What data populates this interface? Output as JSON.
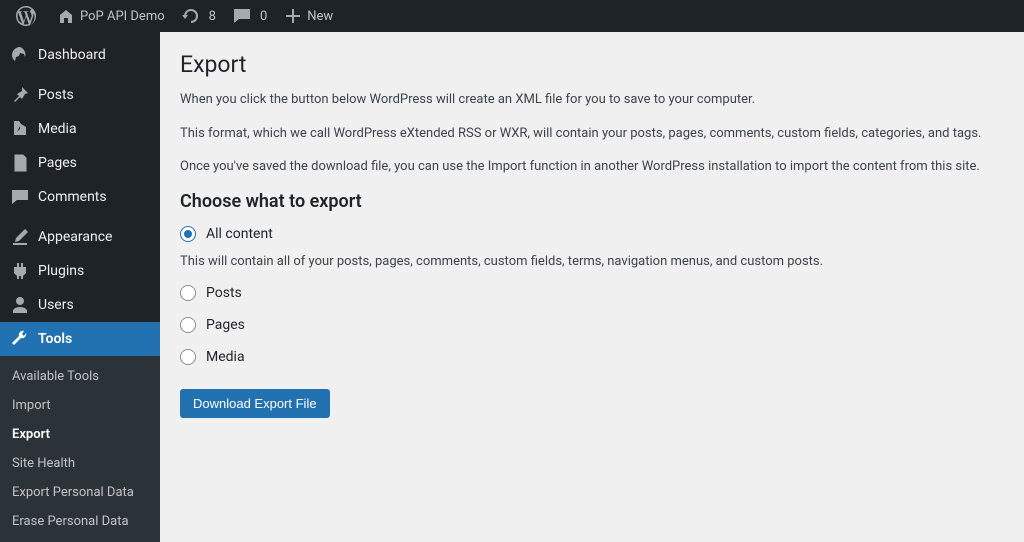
{
  "adminbar": {
    "site_name": "PoP API Demo",
    "updates_count": "8",
    "comments_count": "0",
    "new_label": "New"
  },
  "sidebar": {
    "items": [
      {
        "id": "dashboard",
        "label": "Dashboard",
        "icon": "dashboard-icon"
      },
      {
        "id": "posts",
        "label": "Posts",
        "icon": "pushpin-icon"
      },
      {
        "id": "media",
        "label": "Media",
        "icon": "media-icon"
      },
      {
        "id": "pages",
        "label": "Pages",
        "icon": "page-icon"
      },
      {
        "id": "comments",
        "label": "Comments",
        "icon": "comment-icon"
      },
      {
        "id": "appearance",
        "label": "Appearance",
        "icon": "brush-icon"
      },
      {
        "id": "plugins",
        "label": "Plugins",
        "icon": "plugin-icon"
      },
      {
        "id": "users",
        "label": "Users",
        "icon": "users-icon"
      },
      {
        "id": "tools",
        "label": "Tools",
        "icon": "wrench-icon"
      }
    ],
    "tools_submenu": [
      {
        "label": "Available Tools"
      },
      {
        "label": "Import"
      },
      {
        "label": "Export"
      },
      {
        "label": "Site Health"
      },
      {
        "label": "Export Personal Data"
      },
      {
        "label": "Erase Personal Data"
      }
    ]
  },
  "export": {
    "title": "Export",
    "intro_1": "When you click the button below WordPress will create an XML file for you to save to your computer.",
    "intro_2": "This format, which we call WordPress eXtended RSS or WXR, will contain your posts, pages, comments, custom fields, categories, and tags.",
    "intro_3": "Once you've saved the download file, you can use the Import function in another WordPress installation to import the content from this site.",
    "choose_heading": "Choose what to export",
    "options": [
      {
        "label": "All content",
        "checked": true,
        "description": "This will contain all of your posts, pages, comments, custom fields, terms, navigation menus, and custom posts."
      },
      {
        "label": "Posts",
        "checked": false
      },
      {
        "label": "Pages",
        "checked": false
      },
      {
        "label": "Media",
        "checked": false
      }
    ],
    "button_label": "Download Export File"
  }
}
